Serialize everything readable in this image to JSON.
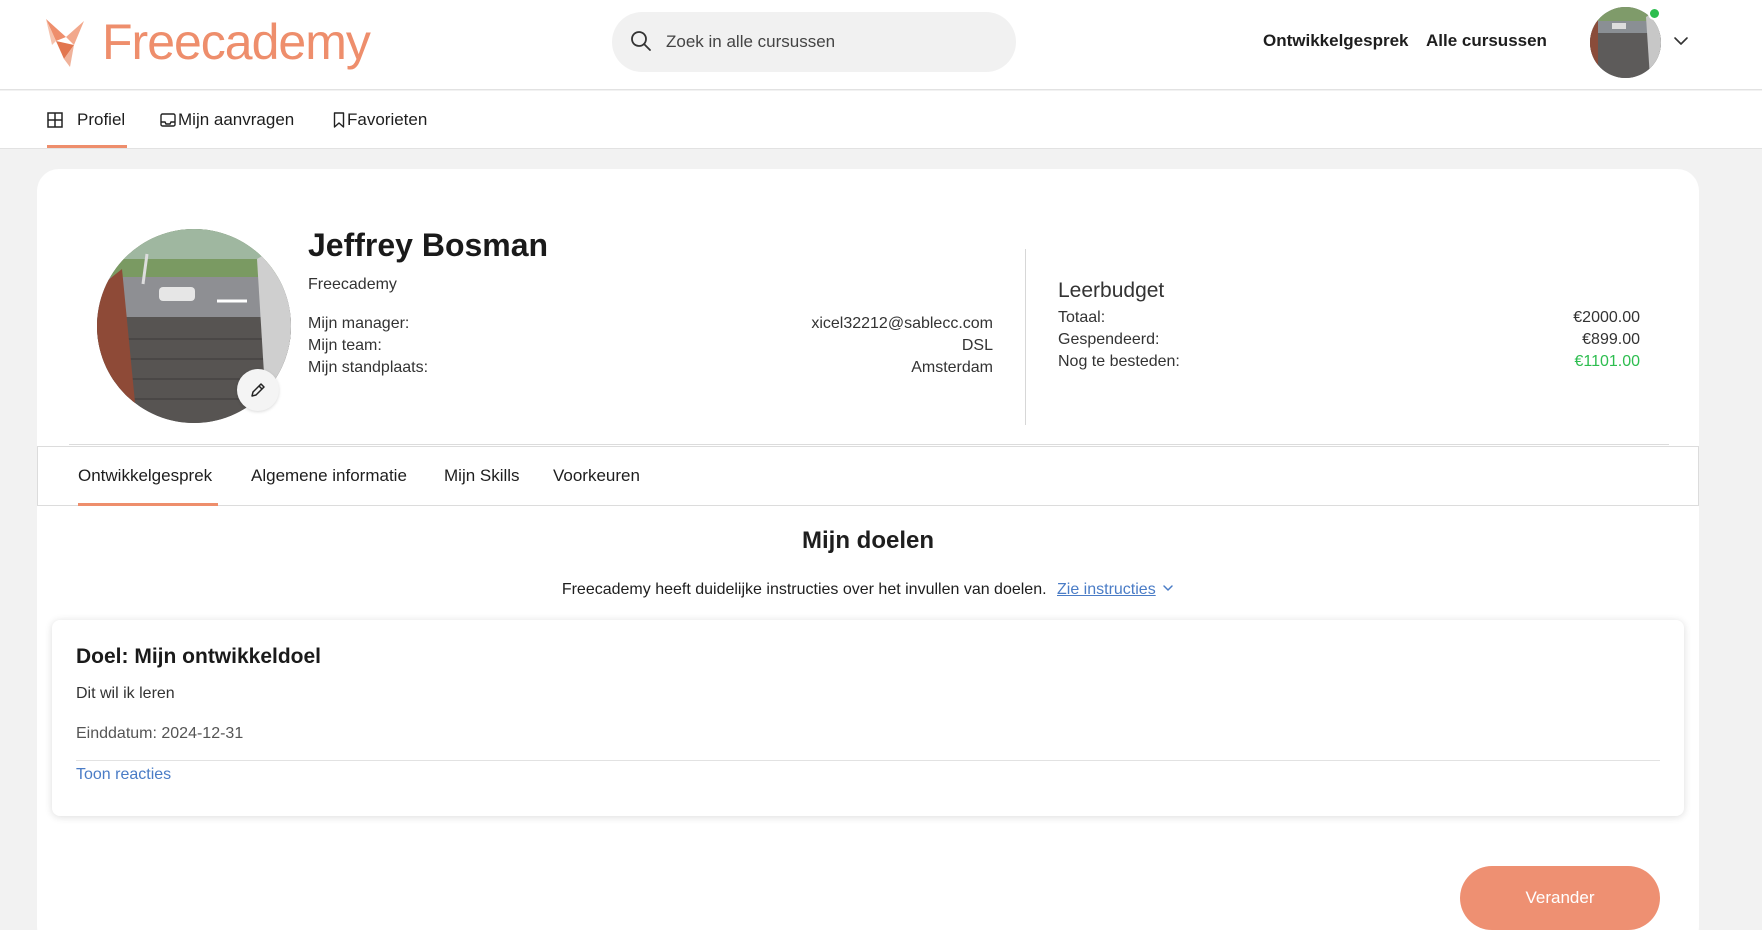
{
  "header": {
    "logo_text": "Freecademy",
    "search_placeholder": "Zoek in alle cursussen",
    "nav": [
      "Ontwikkelgesprek",
      "Alle cursussen"
    ]
  },
  "subnav": {
    "items": [
      "Profiel",
      "Mijn aanvragen",
      "Favorieten"
    ],
    "active": "Profiel"
  },
  "profile": {
    "name": "Jeffrey Bosman",
    "company": "Freecademy",
    "fields": [
      {
        "label": "Mijn manager:",
        "value": "xicel32212@sablecc.com"
      },
      {
        "label": "Mijn team:",
        "value": "DSL"
      },
      {
        "label": "Mijn standplaats:",
        "value": "Amsterdam"
      }
    ]
  },
  "budget": {
    "title": "Leerbudget",
    "rows": [
      {
        "label": "Totaal:",
        "value": "€2000.00"
      },
      {
        "label": "Gespendeerd:",
        "value": "€899.00"
      },
      {
        "label": "Nog te besteden:",
        "value": "€1101.00"
      }
    ],
    "remaining_color": "#2dbd4f"
  },
  "tabs": {
    "items": [
      "Ontwikkelgesprek",
      "Algemene informatie",
      "Mijn Skills",
      "Voorkeuren"
    ],
    "active": "Ontwikkelgesprek"
  },
  "goals": {
    "title": "Mijn doelen",
    "instructions_text": "Freecademy heeft duidelijke instructies over het invullen van doelen.",
    "instructions_link": "Zie instructies",
    "goal": {
      "title": "Doel: Mijn ontwikkeldoel",
      "description": "Dit wil ik leren",
      "end_date": "Einddatum: 2024-12-31",
      "show_reactions": "Toon reacties"
    },
    "change_button": "Verander"
  },
  "colors": {
    "accent": "#ee8e6c",
    "link": "#4a7cc6",
    "online": "#2dbd4f"
  }
}
